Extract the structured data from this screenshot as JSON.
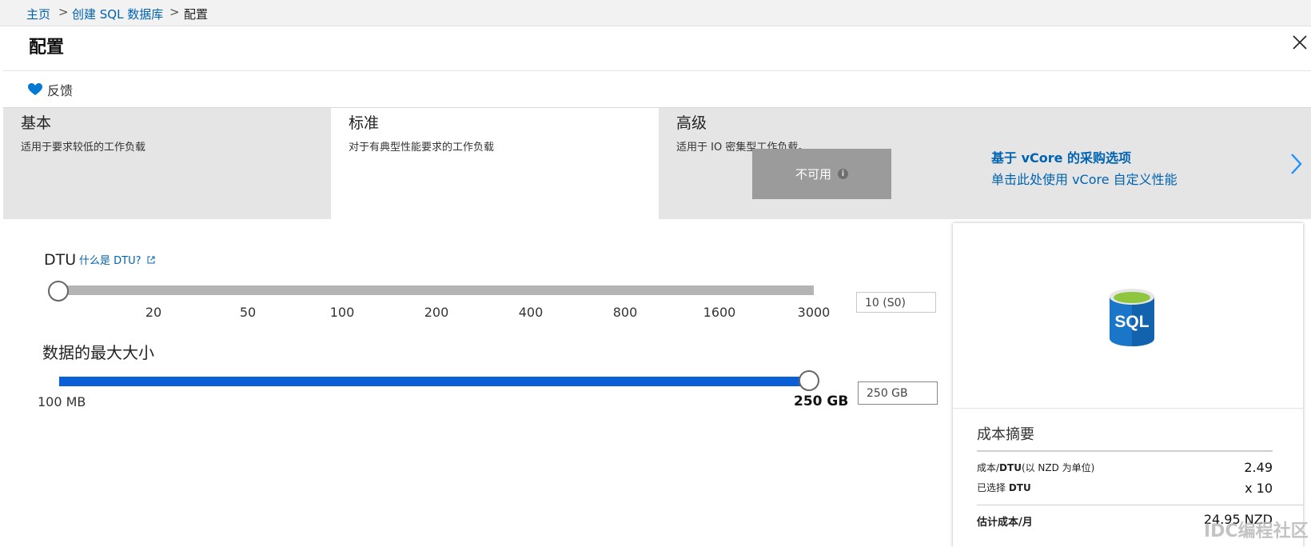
{
  "breadcrumb": {
    "items": [
      "主页",
      "创建 SQL 数据库",
      "配置"
    ],
    "separator": ">"
  },
  "blade": {
    "title": "配置",
    "close_icon": "close-icon"
  },
  "command_bar": {
    "feedback_label": "反馈",
    "feedback_icon": "heart-icon",
    "feedback_color": "#0078d4"
  },
  "tiers": [
    {
      "title": "基本",
      "description": "适用于要求较低的工作负载",
      "selected": false
    },
    {
      "title": "标准",
      "description": "对于有典型性能要求的工作负载",
      "selected": true
    },
    {
      "title": "高级",
      "description": "适用于 IO 密集型工作负载。",
      "selected": false,
      "badge": "不可用"
    }
  ],
  "vcore_option": {
    "title": "基于 vCore 的采购选项",
    "subtitle": "单击此处使用 vCore 自定义性能",
    "chevron_icon": "chevron-right-icon"
  },
  "dtu": {
    "label": "DTU",
    "help_link": "什么是 DTU?",
    "ticks": [
      "20",
      "50",
      "100",
      "200",
      "400",
      "800",
      "1600",
      "3000"
    ],
    "value_fraction": 0,
    "input_value": "10 (S0)"
  },
  "storage": {
    "label": "数据的最大大小",
    "min_label": "100 MB",
    "max_label": "250 GB",
    "value_fraction": 1,
    "input_value": "250 GB",
    "accent": "#0b5fd6"
  },
  "cost_summary": {
    "logo_text": "SQL",
    "title": "成本摘要",
    "rows": [
      {
        "label_prefix": "成本/",
        "label_bold": "DTU",
        "label_suffix": "(以 NZD 为单位)",
        "value": "2.49"
      },
      {
        "label_prefix": "已选择 ",
        "label_bold": "DTU",
        "label_suffix": "",
        "value": "x 10"
      }
    ],
    "total_label": "估计成本/月",
    "total_value": "24.95 NZD"
  },
  "watermark": "IDC编程社区"
}
